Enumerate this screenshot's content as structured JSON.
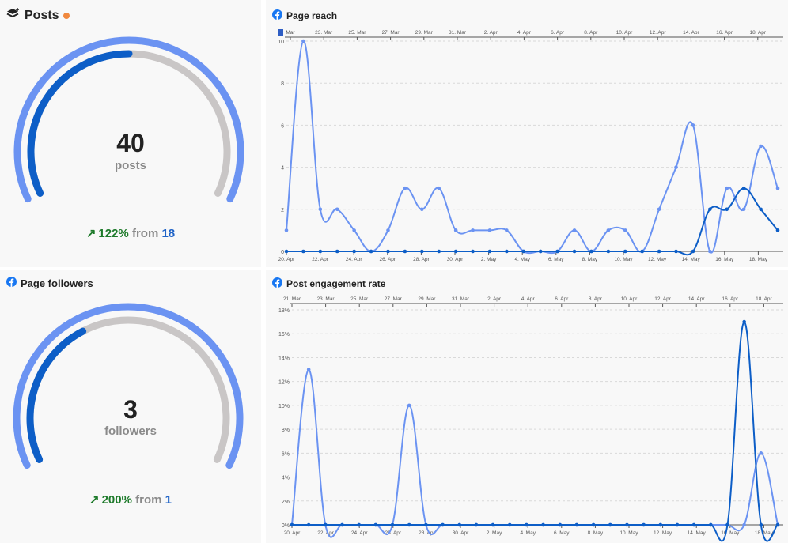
{
  "colors": {
    "light": "#6b93f2",
    "dark": "#0d5ec7",
    "track": "#c9c6c6",
    "fb": "#1877f2"
  },
  "posts": {
    "title": "Posts",
    "value": "40",
    "unit": "posts",
    "delta_pct": "122%",
    "from_label": "from",
    "previous": "18",
    "arrow": "↗",
    "progress": 0.5,
    "status_dot_color": "#f0883e"
  },
  "followers": {
    "title": "Page followers",
    "value": "3",
    "unit": "followers",
    "delta_pct": "200%",
    "from_label": "from",
    "previous": "1",
    "arrow": "↗",
    "progress": 0.38
  },
  "chart_data": [
    {
      "type": "line",
      "title": "Page reach",
      "x_bottom": [
        "20. Apr",
        "22. Apr",
        "24. Apr",
        "26. Apr",
        "28. Apr",
        "30. Apr",
        "2. May",
        "4. May",
        "6. May",
        "8. May",
        "10. May",
        "12. May",
        "14. May",
        "16. May",
        "18. May"
      ],
      "x_top": [
        "Mar",
        "23. Mar",
        "25. Mar",
        "27. Mar",
        "29. Mar",
        "31. Mar",
        "2. Apr",
        "4. Apr",
        "6. Apr",
        "8. Apr",
        "10. Apr",
        "12. Apr",
        "14. Apr",
        "16. Apr",
        "18. Apr"
      ],
      "y_ticks": [
        "0",
        "2",
        "4",
        "6",
        "8",
        "10"
      ],
      "ylim": [
        0,
        10
      ],
      "series": [
        {
          "values": [
            1,
            10,
            2,
            2,
            1,
            0,
            1,
            3,
            2,
            3,
            1,
            1,
            1,
            1,
            0,
            0,
            0,
            1,
            0,
            1,
            1,
            0,
            2,
            4,
            6,
            0,
            3,
            2,
            5,
            3
          ]
        },
        {
          "values": [
            0,
            0,
            0,
            0,
            0,
            0,
            0,
            0,
            0,
            0,
            0,
            0,
            0,
            0,
            0,
            0,
            0,
            0,
            0,
            0,
            0,
            0,
            0,
            0,
            0,
            2,
            2,
            3,
            2,
            1
          ]
        }
      ]
    },
    {
      "type": "line",
      "title": "Post engagement rate",
      "x_bottom": [
        "20. Apr",
        "22. Apr",
        "24. Apr",
        "26. Apr",
        "28. Apr",
        "30. Apr",
        "2. May",
        "4. May",
        "6. May",
        "8. May",
        "10. May",
        "12. May",
        "14. May",
        "16. May",
        "18. May"
      ],
      "x_top": [
        "21. Mar",
        "23. Mar",
        "25. Mar",
        "27. Mar",
        "29. Mar",
        "31. Mar",
        "2. Apr",
        "4. Apr",
        "6. Apr",
        "8. Apr",
        "10. Apr",
        "12. Apr",
        "14. Apr",
        "16. Apr",
        "18. Apr"
      ],
      "y_ticks": [
        "0%",
        "2%",
        "4%",
        "6%",
        "8%",
        "10%",
        "12%",
        "14%",
        "16%",
        "18%"
      ],
      "ylim": [
        0,
        18
      ],
      "series": [
        {
          "values": [
            0,
            13,
            0,
            0,
            0,
            0,
            0,
            10,
            0,
            0,
            0,
            0,
            0,
            0,
            0,
            0,
            0,
            0,
            0,
            0,
            0,
            0,
            0,
            0,
            0,
            0,
            0,
            0,
            6,
            0
          ]
        },
        {
          "values": [
            0,
            0,
            0,
            0,
            0,
            0,
            0,
            0,
            0,
            0,
            0,
            0,
            0,
            0,
            0,
            0,
            0,
            0,
            0,
            0,
            0,
            0,
            0,
            0,
            0,
            0,
            0,
            17,
            0,
            0
          ]
        }
      ]
    }
  ]
}
